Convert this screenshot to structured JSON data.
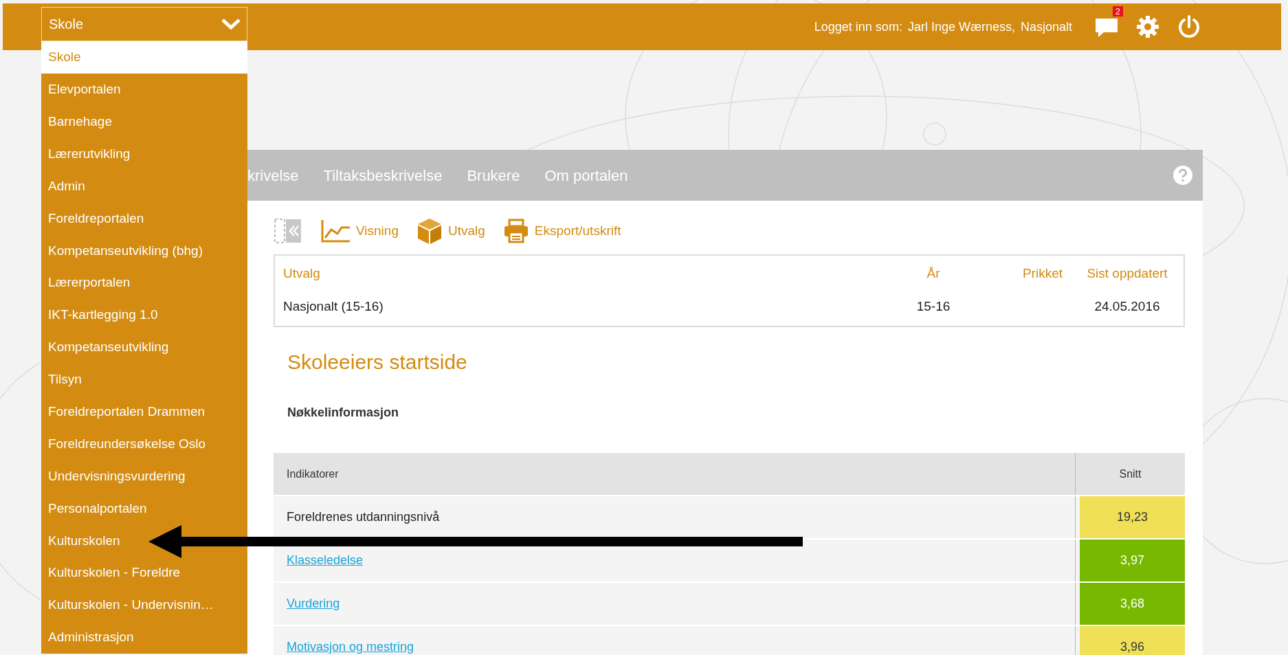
{
  "app_switcher": {
    "value": "Skole",
    "expanded": true,
    "items": [
      {
        "label": "Skole",
        "selected": true
      },
      {
        "label": "Elevportalen",
        "selected": false
      },
      {
        "label": "Barnehage",
        "selected": false
      },
      {
        "label": "Lærerutvikling",
        "selected": false
      },
      {
        "label": "Admin",
        "selected": false
      },
      {
        "label": "Foreldreportalen",
        "selected": false
      },
      {
        "label": "Kompetanseutvikling (bhg)",
        "selected": false
      },
      {
        "label": "Lærerportalen",
        "selected": false
      },
      {
        "label": "IKT-kartlegging 1.0",
        "selected": false
      },
      {
        "label": "Kompetanseutvikling",
        "selected": false
      },
      {
        "label": "Tilsyn",
        "selected": false
      },
      {
        "label": "Foreldreportalen Drammen",
        "selected": false
      },
      {
        "label": "Foreldreundersøkelse Oslo",
        "selected": false
      },
      {
        "label": "Undervisningsvurdering",
        "selected": false
      },
      {
        "label": "Personalportalen",
        "selected": false
      },
      {
        "label": "Kulturskolen",
        "selected": false
      },
      {
        "label": "Kulturskolen - Foreldre",
        "selected": false
      },
      {
        "label": "Kulturskolen - Undervisnin…",
        "selected": false
      },
      {
        "label": "Administrasjon",
        "selected": false
      }
    ]
  },
  "user": {
    "label": "Logget inn som:",
    "name": "Jarl Inge Wærness,",
    "role": "Nasjonalt"
  },
  "notifications": {
    "count": "2"
  },
  "nav": [
    "krivelse",
    "Tiltaksbeskrivelse",
    "Brukere",
    "Om portalen"
  ],
  "toolbar": [
    {
      "kind": "collapse"
    },
    {
      "kind": "chart",
      "label": "Visning"
    },
    {
      "kind": "box",
      "label": "Utvalg"
    },
    {
      "kind": "print",
      "label": "Eksport/utskrift"
    }
  ],
  "selection": {
    "columns": [
      "Utvalg",
      "År",
      "Prikket",
      "Sist oppdatert"
    ],
    "row": {
      "utvalg": "Nasjonalt (15-16)",
      "year": "15-16",
      "updated": "24.05.2016"
    }
  },
  "title": "Skoleeiers startside",
  "section": "Nøkkelinformasjon",
  "indicators": {
    "columns": [
      "Indikatorer",
      "Snitt"
    ],
    "rows": [
      {
        "name": "Foreldrenes utdanningsnivå",
        "link": false,
        "value": "19,23",
        "color": "#efe058"
      },
      {
        "name": "Klasseledelse",
        "link": true,
        "value": "3,97",
        "color": "#77b900"
      },
      {
        "name": "Vurdering",
        "link": true,
        "value": "3,68",
        "color": "#77b900"
      },
      {
        "name": "Motivasjon og mestring",
        "link": true,
        "value": "3,96",
        "color": "#efe058"
      }
    ]
  }
}
